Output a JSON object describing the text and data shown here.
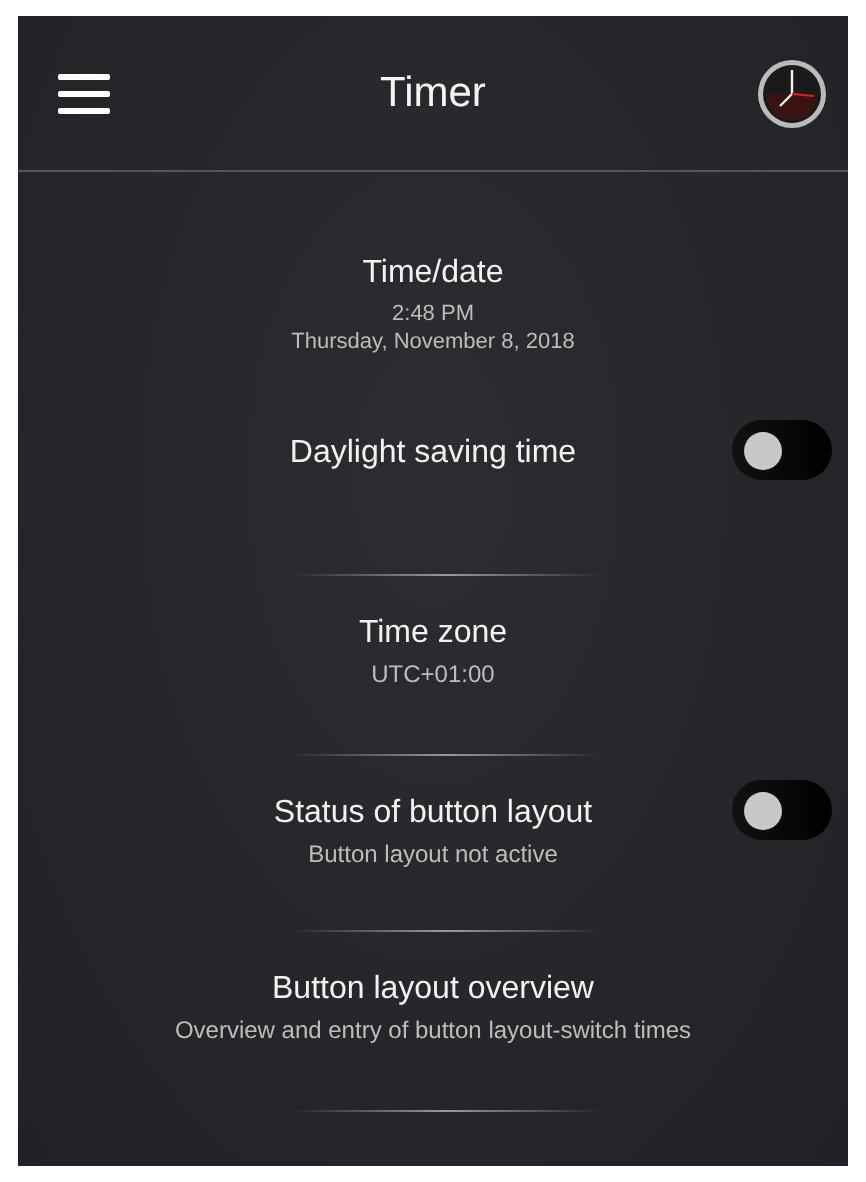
{
  "header": {
    "title": "Timer"
  },
  "items": [
    {
      "kind": "plain",
      "title": "Time/date",
      "lines": [
        "2:48 PM",
        "Thursday, November 8, 2018"
      ]
    },
    {
      "kind": "toggle",
      "title": "Daylight saving time",
      "on": false
    },
    {
      "kind": "plain",
      "title": "Time zone",
      "lines": [
        "UTC+01:00"
      ]
    },
    {
      "kind": "toggle",
      "title": "Status of button layout",
      "lines": [
        "Button layout not active"
      ],
      "on": false
    },
    {
      "kind": "plain",
      "title": "Button layout overview",
      "lines": [
        "Overview and entry of button layout-switch times"
      ]
    }
  ]
}
